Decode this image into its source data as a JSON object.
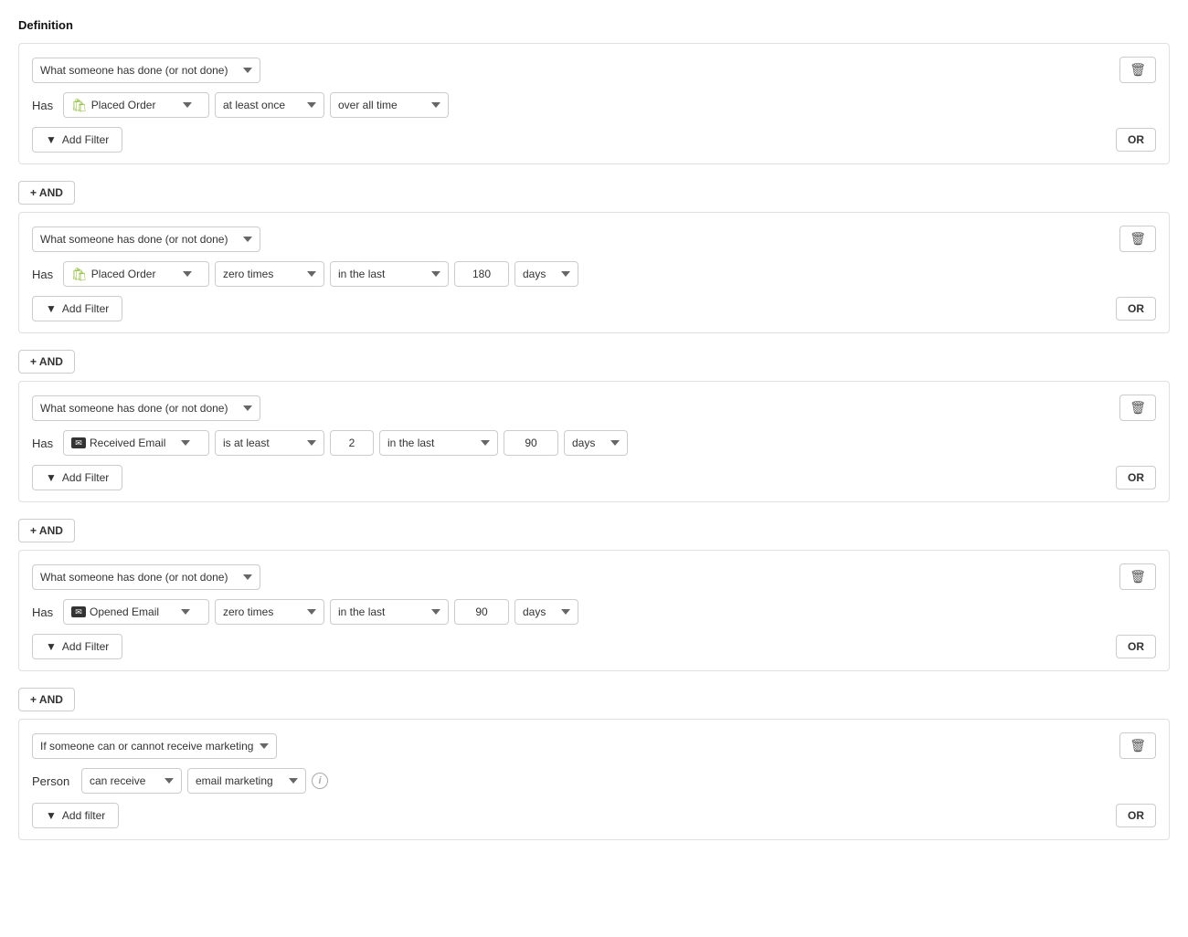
{
  "page": {
    "title": "Definition"
  },
  "blocks": [
    {
      "id": "block-1",
      "type": "action",
      "dropdown_main": "What someone has done (or not done)",
      "has_label": "Has",
      "event": "Placed Order",
      "event_icon": "shopify",
      "frequency": "at least once",
      "time_range": "over all time",
      "show_number": false,
      "show_days": false,
      "number_value": "",
      "days_value": "",
      "days_unit": "",
      "add_filter_label": "Add Filter",
      "or_label": "OR"
    },
    {
      "id": "block-2",
      "type": "action",
      "dropdown_main": "What someone has done (or not done)",
      "has_label": "Has",
      "event": "Placed Order",
      "event_icon": "shopify",
      "frequency": "zero times",
      "time_range": "in the last",
      "show_number": true,
      "show_days": true,
      "number_value": "180",
      "days_value": "days",
      "add_filter_label": "Add Filter",
      "or_label": "OR"
    },
    {
      "id": "block-3",
      "type": "action",
      "dropdown_main": "What someone has done (or not done)",
      "has_label": "Has",
      "event": "Received Email",
      "event_icon": "email",
      "frequency": "is at least",
      "show_count": true,
      "count_value": "2",
      "time_range": "in the last",
      "show_number": true,
      "show_days": true,
      "number_value": "90",
      "days_value": "days",
      "add_filter_label": "Add Filter",
      "or_label": "OR"
    },
    {
      "id": "block-4",
      "type": "action",
      "dropdown_main": "What someone has done (or not done)",
      "has_label": "Has",
      "event": "Opened Email",
      "event_icon": "email",
      "frequency": "zero times",
      "time_range": "in the last",
      "show_number": true,
      "show_days": true,
      "number_value": "90",
      "days_value": "days",
      "add_filter_label": "Add Filter",
      "or_label": "OR"
    },
    {
      "id": "block-5",
      "type": "marketing",
      "dropdown_main": "If someone can or cannot receive marketing",
      "person_label": "Person",
      "receive": "can receive",
      "marketing_type": "email marketing",
      "add_filter_label": "Add filter",
      "or_label": "OR"
    }
  ],
  "and_label": "+ AND",
  "delete_icon": "🗑",
  "filter_icon": "⧖"
}
